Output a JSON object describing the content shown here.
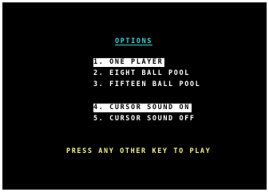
{
  "screen": {
    "title": "OPTIONS",
    "menu_group_players": [
      {
        "label": "1. ONE PLAYER",
        "selected": true
      },
      {
        "label": "2. EIGHT BALL POOL",
        "selected": false
      },
      {
        "label": "3. FIFTEEN BALL POOL",
        "selected": false
      }
    ],
    "menu_group_sound": [
      {
        "label": "4. CURSOR SOUND ON",
        "selected": true
      },
      {
        "label": "5. CURSOR SOUND OFF",
        "selected": false
      }
    ],
    "prompt": "PRESS ANY OTHER KEY TO PLAY"
  },
  "colors": {
    "background": "#000000",
    "title": "#2fd6d6",
    "menu_text": "#ffffff",
    "prompt": "#f2f27a"
  }
}
